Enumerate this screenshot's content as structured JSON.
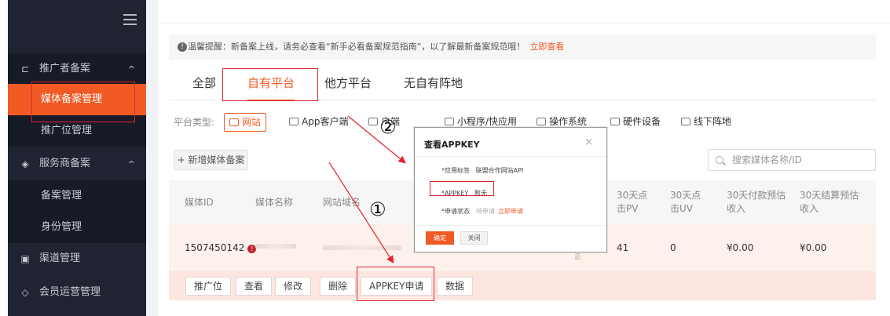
{
  "sidebar": {
    "items": [
      {
        "label": "推广者备案",
        "icon": "megaphone-icon",
        "arrow": "^"
      },
      {
        "label": "媒体备案管理"
      },
      {
        "label": "推广位管理"
      },
      {
        "label": "服务商备案",
        "icon": "handshake-icon",
        "arrow": "^"
      },
      {
        "label": "备案管理"
      },
      {
        "label": "身份管理"
      },
      {
        "label": "渠道管理",
        "icon": "channel-icon"
      },
      {
        "label": "会员运营管理",
        "icon": "diamond-icon"
      }
    ]
  },
  "notice": {
    "text": "温馨提醒：新备案上线，请务必查看“新手必看备案规范指南”，以了解最新备案规范哦！",
    "link": "立即查看"
  },
  "tabs": [
    "全部",
    "自有平台",
    "他方平台",
    "无自有阵地"
  ],
  "platform": {
    "label": "平台类型:",
    "options": [
      "网站",
      "App客户端",
      "户端",
      "小程序/快应用",
      "操作系统",
      "硬件设备",
      "线下阵地"
    ]
  },
  "toolbar": {
    "add_label": "+ 新增媒体备案",
    "search_placeholder": "搜索媒体名称/ID"
  },
  "table": {
    "headers": [
      "媒体ID",
      "媒体名称",
      "网站域名",
      "30天点击PV",
      "30天点击UV",
      "30天付款预估收入",
      "30天结算预估收入"
    ],
    "row": {
      "id": "1507450142",
      "warn": "!",
      "pv": "41",
      "uv": "0",
      "pay": "¥0.00",
      "settle": "¥0.00",
      "partial": "正"
    }
  },
  "actions": [
    "推广位",
    "查看",
    "修改",
    "删除",
    "APPKEY申请",
    "数据"
  ],
  "modal": {
    "title": "查看APPKEY",
    "close": "×",
    "app_tag_key": "*应用标签",
    "app_tag_value": "联盟合作网站API",
    "appkey_key": "*APPKEY",
    "appkey_value": "暂无",
    "status_key": "*申请状态",
    "status_value": "待申请",
    "status_link": "立即申请",
    "ok": "确定",
    "cancel": "关闭"
  },
  "annotations": {
    "one": "①",
    "two": "②"
  },
  "colors": {
    "accent": "#f15a24",
    "sidebar": "#1f2332",
    "highlight": "#e8222d"
  }
}
